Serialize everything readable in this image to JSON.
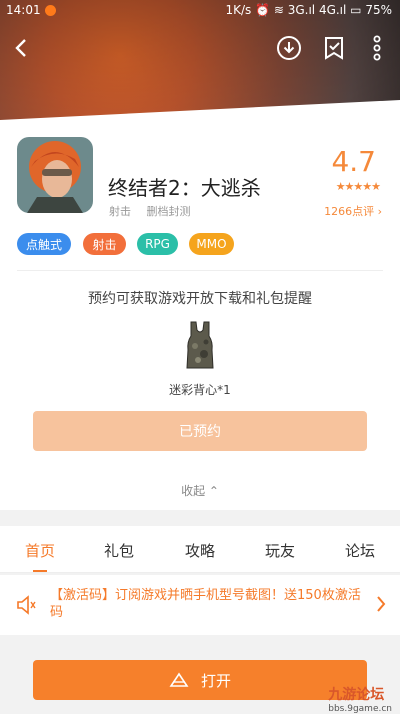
{
  "statusbar": {
    "time": "14:01",
    "right": "1K/s ⏰ ≋ 3G.ıl 4G.ıl ▭ 75%"
  },
  "app": {
    "title": "终结者2：大逃杀",
    "subtags": [
      "射击",
      "删档封测"
    ],
    "rating": "4.7",
    "stars": "★★★★★",
    "reviews": "1266点评 ›"
  },
  "chips": [
    {
      "label": "点触式",
      "color": "#3b8ded"
    },
    {
      "label": "射击",
      "color": "#f26f3b"
    },
    {
      "label": "RPG",
      "color": "#2bbfa8"
    },
    {
      "label": "MMO",
      "color": "#f5a41d"
    }
  ],
  "reserve": {
    "prompt": "预约可获取游戏开放下载和礼包提醒",
    "gift_name": "迷彩背心*1",
    "button": "已预约",
    "collapse": "收起 ⌃"
  },
  "tabs": [
    "首页",
    "礼包",
    "攻略",
    "玩友",
    "论坛"
  ],
  "active_tab": "首页",
  "notice": {
    "text": "【激活码】订阅游戏并晒手机型号截图！送150枚激活码"
  },
  "bottom": {
    "open_label": "打开"
  },
  "watermark": {
    "name": "九游论坛",
    "site": "bbs.9game.cn"
  },
  "icons": {
    "back": "back-arrow-icon",
    "download": "download-icon",
    "bookmark": "bookmark-check-icon",
    "more": "more-vertical-icon",
    "speaker": "speaker-icon",
    "chevron": "chevron-right-icon",
    "open": "triangle-open-icon"
  }
}
